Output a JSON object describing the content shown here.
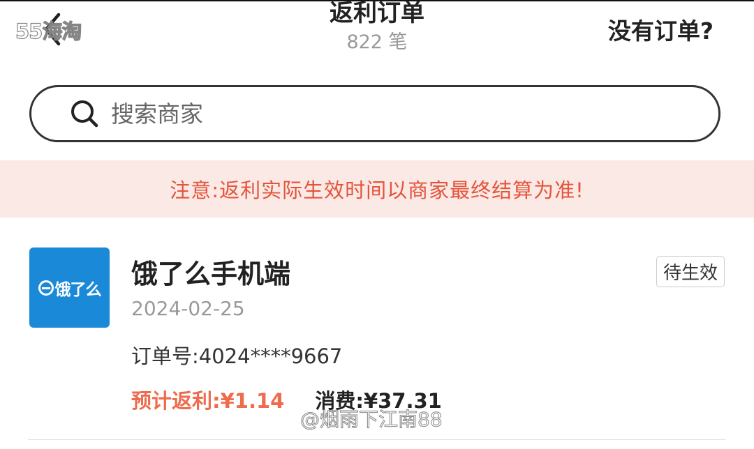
{
  "header": {
    "back_icon": "chevron-left-icon",
    "watermark_logo": "55海淘",
    "title": "返利订单",
    "order_count": "822 笔",
    "no_order_label": "没有订单?"
  },
  "search": {
    "icon": "search-icon",
    "placeholder": "搜索商家"
  },
  "notice": {
    "text": "注意:返利实际生效时间以商家最终结算为准!"
  },
  "orders": [
    {
      "merchant_logo_text": "饿了么",
      "merchant_name": "饿了么手机端",
      "status": "待生效",
      "date": "2024-02-25",
      "order_number_label": "订单号:",
      "order_number": "4024****9667",
      "rebate_label": "预计返利:",
      "rebate_value": "¥1.14",
      "spend_label": "消费:",
      "spend_value": "¥37.31"
    }
  ],
  "watermark_user": "@烟雨下江南88",
  "colors": {
    "accent": "#ee6c4d",
    "notice_bg": "#fbe9e6",
    "notice_text": "#e4543a",
    "merchant_logo_bg": "#1a89d8"
  }
}
